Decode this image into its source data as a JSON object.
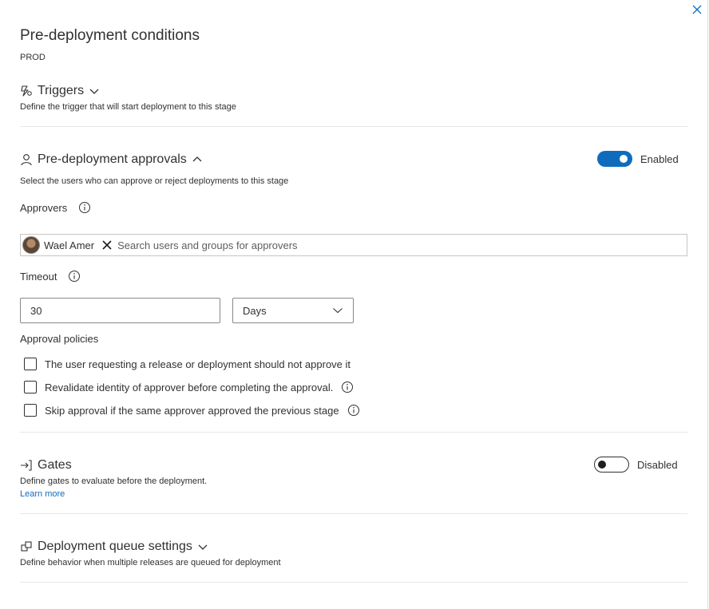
{
  "panel": {
    "title": "Pre-deployment conditions",
    "stage_name": "PROD"
  },
  "triggers": {
    "icon": "trigger-lightning-icon",
    "title": "Triggers",
    "description": "Define the trigger that will start deployment to this stage",
    "expanded": false
  },
  "approvals": {
    "icon": "person-icon",
    "title": "Pre-deployment approvals",
    "description": "Select the users who can approve or reject deployments to this stage",
    "expanded": true,
    "toggle": {
      "on": true,
      "label": "Enabled"
    },
    "approvers_label": "Approvers",
    "approvers": [
      {
        "name": "Wael Amer",
        "icon": "user-avatar"
      }
    ],
    "search_placeholder": "Search users and groups for approvers",
    "timeout_label": "Timeout",
    "timeout_value": "30",
    "timeout_unit": "Days",
    "policies_label": "Approval policies",
    "policies": [
      {
        "label": "The user requesting a release or deployment should not approve it",
        "checked": false,
        "info": false
      },
      {
        "label": "Revalidate identity of approver before completing the approval.",
        "checked": false,
        "info": true
      },
      {
        "label": "Skip approval if the same approver approved the previous stage",
        "checked": false,
        "info": true
      }
    ]
  },
  "gates": {
    "icon": "gate-arrow-icon",
    "title": "Gates",
    "description": "Define gates to evaluate before the deployment.",
    "learn_more": "Learn more",
    "toggle": {
      "on": false,
      "label": "Disabled"
    }
  },
  "queue": {
    "icon": "queue-settings-icon",
    "title": "Deployment queue settings",
    "description": "Define behavior when multiple releases are queued for deployment",
    "expanded": false
  },
  "colors": {
    "accent": "#0f6cbd",
    "text": "#323130",
    "border": "#8a8886",
    "divider": "#e8e6e4"
  }
}
